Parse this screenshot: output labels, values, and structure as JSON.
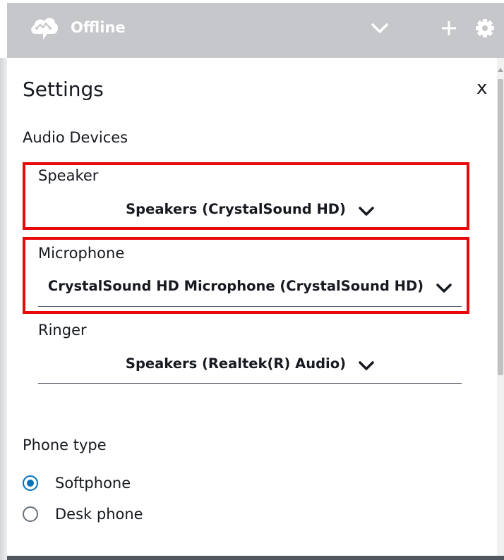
{
  "header": {
    "status": "Offline",
    "icons": {
      "logo": "cloud-phone-icon",
      "collapse": "chevron-down-icon",
      "add": "plus-icon",
      "settings": "gear-icon"
    },
    "background_color": "#c6c7ca"
  },
  "settings": {
    "title": "Settings",
    "close_label": "x"
  },
  "audio_devices": {
    "heading": "Audio Devices",
    "speaker": {
      "label": "Speaker",
      "value": "Speakers (CrystalSound HD)"
    },
    "microphone": {
      "label": "Microphone",
      "value": "CrystalSound HD Microphone (CrystalSound HD)"
    },
    "ringer": {
      "label": "Ringer",
      "value": "Speakers (Realtek(R) Audio)"
    }
  },
  "phone_type": {
    "heading": "Phone type",
    "options": [
      {
        "label": "Softphone",
        "selected": true
      },
      {
        "label": "Desk phone",
        "selected": false
      }
    ]
  },
  "colors": {
    "highlight": "#e80a0a",
    "radio_accent": "#0073bb",
    "text": "#16191f"
  }
}
